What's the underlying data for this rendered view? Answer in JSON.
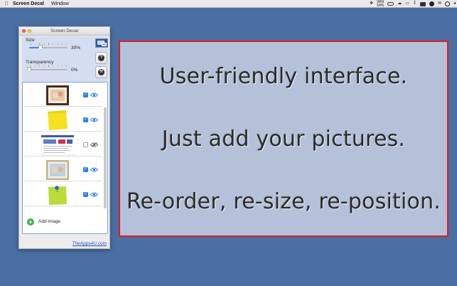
{
  "menubar": {
    "apple_icon": "apple-logo-icon",
    "app_name": "Screen Decal",
    "menus": [
      "Window"
    ],
    "battery_label_top": "WIN",
    "battery_label_bottom": "54%"
  },
  "window": {
    "title": "Screen Decal",
    "size_label": "Size",
    "size_value": "30%",
    "size_level": 0.3,
    "transparency_label": "Transparency",
    "transparency_value": "0%",
    "transparency_level": 0.0,
    "help_glyph": "?",
    "list": [
      {
        "name": "framed-photo-baby",
        "checked": true,
        "visible": true
      },
      {
        "name": "yellow-sticky-note",
        "checked": true,
        "visible": true
      },
      {
        "name": "webpage-screenshot",
        "checked": false,
        "visible": false
      },
      {
        "name": "framed-photo-family",
        "checked": true,
        "visible": true
      },
      {
        "name": "green-sticky-note-pinned",
        "checked": true,
        "visible": true
      }
    ],
    "add_image_label": "Add image",
    "footer_link": "TheApps4U.com"
  },
  "decal": {
    "lines": [
      "User-friendly interface.",
      "Just add your pictures.",
      "Re-order, re-size, re-position."
    ],
    "border_color": "#e11b22",
    "background_color": "#b4c1d8"
  },
  "colors": {
    "desktop": "#4a6fa3",
    "accent": "#2c7ff0"
  }
}
